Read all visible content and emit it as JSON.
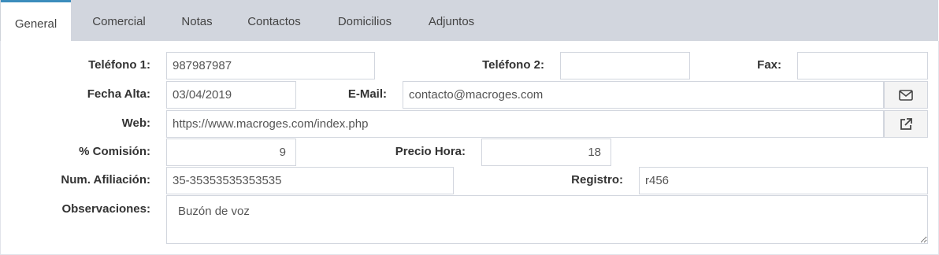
{
  "tabs": [
    {
      "label": "General"
    },
    {
      "label": "Comercial"
    },
    {
      "label": "Notas"
    },
    {
      "label": "Contactos"
    },
    {
      "label": "Domicilios"
    },
    {
      "label": "Adjuntos"
    }
  ],
  "form": {
    "telefono1": {
      "label": "Teléfono 1:",
      "value": "987987987"
    },
    "telefono2": {
      "label": "Teléfono 2:",
      "value": ""
    },
    "fax": {
      "label": "Fax:",
      "value": ""
    },
    "fecha_alta": {
      "label": "Fecha Alta:",
      "value": "03/04/2019"
    },
    "email": {
      "label": "E-Mail:",
      "value": "contacto@macroges.com",
      "icon": "envelope-icon"
    },
    "web": {
      "label": "Web:",
      "value": "https://www.macroges.com/index.php",
      "icon": "external-link-icon"
    },
    "comision": {
      "label": "% Comisión:",
      "value": "9"
    },
    "precio_hora": {
      "label": "Precio Hora:",
      "value": "18"
    },
    "num_afiliacion": {
      "label": "Num. Afiliación:",
      "value": "35-35353535353535"
    },
    "registro": {
      "label": "Registro:",
      "value": "r456"
    },
    "observaciones": {
      "label": "Observaciones:",
      "value": "Buzón de voz"
    }
  },
  "colors": {
    "tab_bar": "#d2d6de",
    "active_tab_accent": "#3c8dbc",
    "input_border": "#d2d6de",
    "addon_background": "#f4f4f4"
  }
}
